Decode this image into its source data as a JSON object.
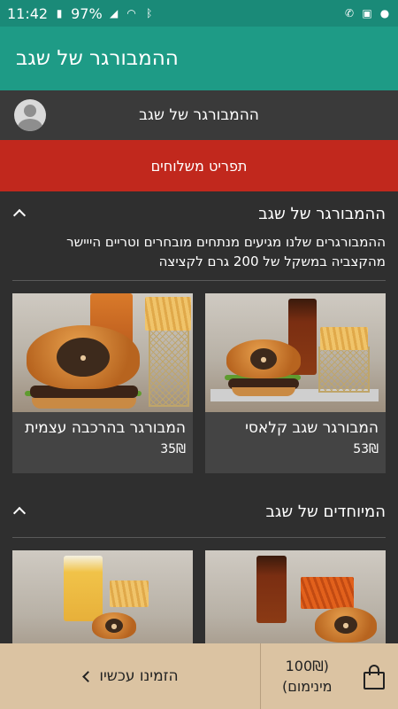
{
  "status_bar": {
    "time": "11:42",
    "battery": "97%"
  },
  "app_bar": {
    "title": "ההמבורגר של שגב"
  },
  "store": {
    "name": "ההמבורגר של שגב"
  },
  "delivery_menu_label": "תפריט משלוחים",
  "sections": [
    {
      "title": "ההמבורגר של שגב",
      "description": "ההמבורגרים שלנו מגיעים מנתחים מובחרים וטריים הייישר מהקצביה במשקל של 200 גרם לקציצה",
      "items": [
        {
          "name": "המבורגר שגב קלאסי",
          "price": "53₪"
        },
        {
          "name": "המבורגר בהרכבה עצמית",
          "price": "35₪"
        }
      ]
    },
    {
      "title": "המיוחדים של שגב"
    }
  ],
  "cart": {
    "minimum_line1": "(100₪",
    "minimum_line2": "מינימום)",
    "order_now": "הזמינו עכשיו"
  },
  "icons": {
    "avatar": "user-avatar-icon",
    "collapse": "chevron-up-icon",
    "cart": "shopping-bag-icon"
  },
  "colors": {
    "status_bar": "#1a8a78",
    "app_bar": "#1e9b86",
    "delivery_bar": "#c1281d",
    "bottom_bar": "#dbc3a2"
  }
}
